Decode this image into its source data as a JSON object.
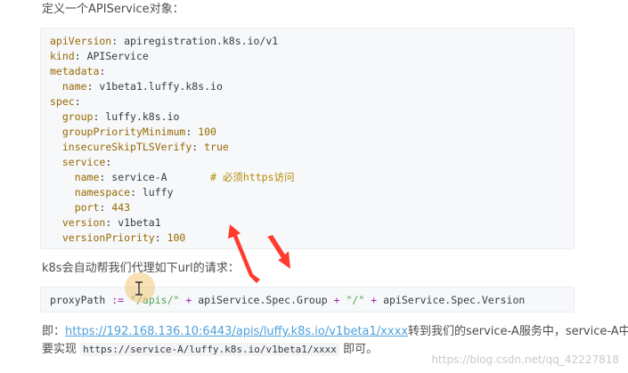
{
  "intro_text": "定义一个APIService对象：",
  "yaml_code": {
    "l1_key": "apiVersion",
    "l1_val": "apiregistration.k8s.io/v1",
    "l2_key": "kind",
    "l2_val": "APIService",
    "l3_key": "metadata",
    "l4_key": "name",
    "l4_val": "v1beta1.luffy.k8s.io",
    "l5_key": "spec",
    "l6_key": "group",
    "l6_val": "luffy.k8s.io",
    "l7_key": "groupPriorityMinimum",
    "l7_val": "100",
    "l8_key": "insecureSkipTLSVerify",
    "l8_val": "true",
    "l9_key": "service",
    "l10_key": "name",
    "l10_val": "service-A",
    "l10_comment": "# 必须https访问",
    "l11_key": "namespace",
    "l11_val": "luffy",
    "l12_key": "port",
    "l12_val": "443",
    "l13_key": "version",
    "l13_val": "v1beta1",
    "l14_key": "versionPriority",
    "l14_val": "100"
  },
  "proxy_text": "k8s会自动帮我们代理如下url的请求：",
  "proxy_code": {
    "lhs": "proxyPath",
    "assign": ":=",
    "str1": "\"/apis/\"",
    "plus": "+",
    "expr1": "apiService.Spec.Group",
    "str2": "\"/\"",
    "expr2": "apiService.Spec.Version"
  },
  "explain": {
    "prefix": "即：",
    "link": "https://192.168.136.10:6443/apis/luffy.k8s.io/v1beta1/xxxx",
    "middle": "转到我们的service-A服务中，service-A中只需",
    "line2_prefix": "要实现",
    "code": "https://service-A/luffy.k8s.io/v1beta1/xxxx",
    "suffix": "即可。"
  },
  "watermark": "https://blog.csdn.net/qq_42227818",
  "colors": {
    "annotation_arrow": "#ff3b30",
    "link": "#4ea1db",
    "code_bg": "#f6f8fa"
  }
}
